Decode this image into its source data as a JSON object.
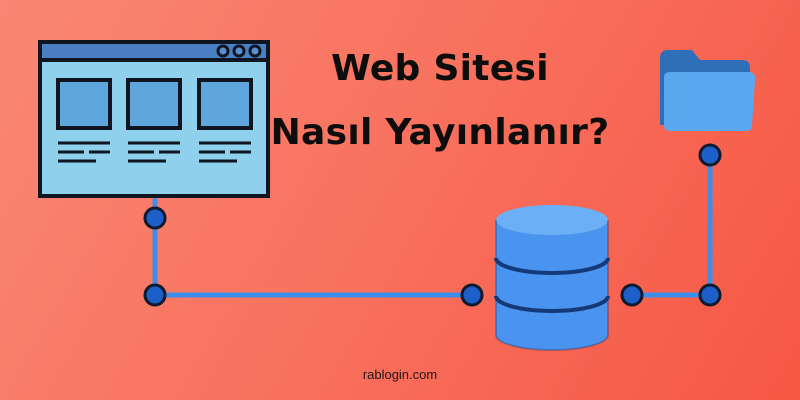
{
  "title": {
    "line1": "Web Sitesi",
    "line2": "Nasıl Yayınlanır?"
  },
  "footer": {
    "url": "rablogin.com"
  },
  "icons": {
    "browser": "browser-window-icon",
    "database": "database-icon",
    "folder": "folder-icon"
  },
  "colors": {
    "background": "#f8735f",
    "connector": "#3d8ee8",
    "node": "#1c5fc9",
    "browser_frame": "#0f1620",
    "browser_fill": "#8fd0ec",
    "database": "#4a94f0",
    "folder_back": "#2f6fb8",
    "folder_front": "#5aa8ef"
  }
}
